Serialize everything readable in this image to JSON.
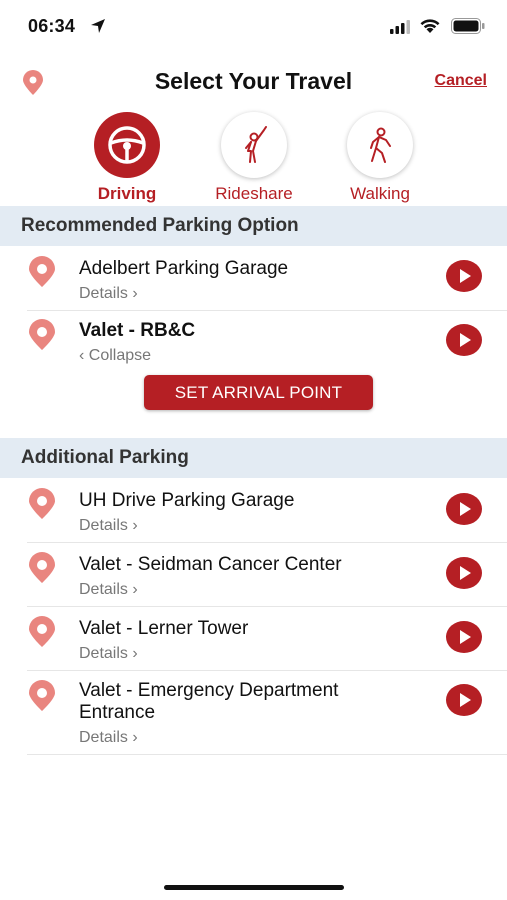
{
  "status_bar": {
    "time": "06:34"
  },
  "header": {
    "title": "Select Your Travel",
    "cancel_label": "Cancel"
  },
  "travel_modes": [
    {
      "label": "Driving",
      "icon": "steering-wheel-icon",
      "selected": true
    },
    {
      "label": "Rideshare",
      "icon": "hailing-person-icon",
      "selected": false
    },
    {
      "label": "Walking",
      "icon": "walking-person-icon",
      "selected": false
    }
  ],
  "recommended": {
    "heading": "Recommended Parking Option",
    "items": [
      {
        "title": "Adelbert Parking Garage",
        "subtitle": "Details ›"
      },
      {
        "title": "Valet - RB&C",
        "subtitle": "‹ Collapse",
        "expanded": true
      }
    ],
    "arrival_button": "SET ARRIVAL POINT"
  },
  "additional": {
    "heading": "Additional Parking",
    "items": [
      {
        "title": "UH Drive Parking Garage",
        "subtitle": "Details ›"
      },
      {
        "title": "Valet - Seidman Cancer Center",
        "subtitle": "Details ›"
      },
      {
        "title": "Valet - Lerner Tower",
        "subtitle": "Details ›"
      },
      {
        "title": "Valet - Emergency Department",
        "title_line2": "Entrance",
        "subtitle": "Details ›"
      }
    ]
  },
  "colors": {
    "accent": "#b51f24",
    "pin": "#e9857f",
    "section_bg": "#e3ebf3"
  }
}
